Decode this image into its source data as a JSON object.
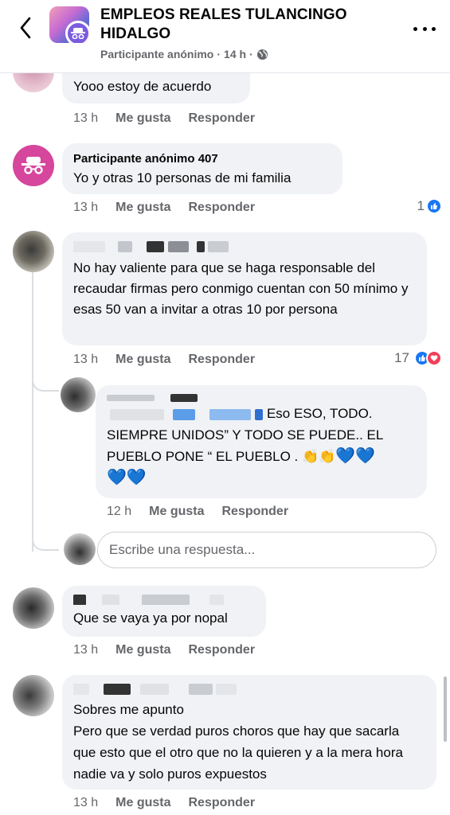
{
  "header": {
    "title": "EMPLEOS REALES TULANCINGO HIDALGO",
    "subtitle_author": "Participante anónimo",
    "subtitle_time": "14 h"
  },
  "comments": [
    {
      "author": "",
      "text": "Yooo estoy de acuerdo",
      "time": "13 h",
      "like": "Me gusta",
      "reply": "Responder"
    },
    {
      "author": "Participante anónimo 407",
      "text": "Yo y otras 10 personas de mi familia",
      "time": "13 h",
      "like": "Me gusta",
      "reply": "Responder",
      "reactions": "1"
    },
    {
      "author": "",
      "text": "No hay valiente para que se haga responsable del recaudar firmas pero conmigo cuentan con 50 mínimo y esas 50 van a invitar a otras 10 por persona",
      "time": "13 h",
      "like": "Me gusta",
      "reply": "Responder",
      "reactions": "17"
    },
    {
      "author": "",
      "text_line1": "Eso ESO, TODO.",
      "text_rest": "SIEMPRE UNIDOS” Y TODO SE PUEDE.. EL PUEBLO PONE “ EL PUEBLO .",
      "time": "12 h",
      "like": "Me gusta",
      "reply": "Responder"
    },
    {
      "author": "",
      "text": "Que se vaya ya por nopal",
      "time": "13 h",
      "like": "Me gusta",
      "reply": "Responder"
    },
    {
      "author": "",
      "text_line1": "Sobres me apunto",
      "text_rest": "Pero que se verdad puros choros que hay que sacarla que esto que el otro que no la quieren y a la mera hora nadie va y solo puros expuestos",
      "time": "13 h",
      "like": "Me gusta",
      "reply": "Responder"
    }
  ],
  "reply_input": {
    "placeholder": "Escribe una respuesta..."
  },
  "colors": {
    "bubble": "#f0f2f5",
    "secondary_text": "#65676b",
    "like_blue": "#1877f2",
    "love_red": "#f33e58",
    "anon_avatar": "#d6469c"
  }
}
